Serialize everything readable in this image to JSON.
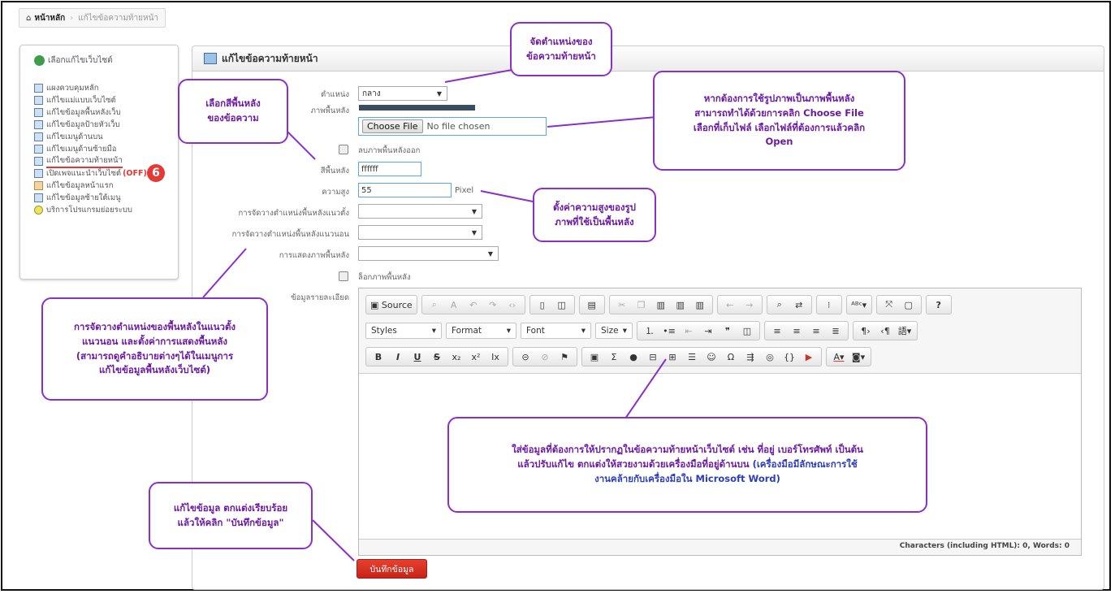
{
  "breadcrumb": {
    "home": "หน้าหลัก",
    "current": "แก้ไขข้อความท้ายหน้า"
  },
  "sidebar": {
    "heading": "เลือกแก้ไขเว็บไซต์",
    "items": [
      {
        "label": "แผงควบคุมหลัก"
      },
      {
        "label": "แก้ไขแม่แบบเว็บไซต์"
      },
      {
        "label": "แก้ไขข้อมูลพื้นหลังเว็บ"
      },
      {
        "label": "แก้ไขข้อมูลป้ายหัวเว็บ"
      },
      {
        "label": "แก้ไขเมนูด้านบน"
      },
      {
        "label": "แก้ไขเมนูด้านซ้ายมือ"
      },
      {
        "label": "แก้ไขข้อความท้ายหน้า"
      },
      {
        "label": "เปิดเพจแนะนำเว็บไซต์",
        "status": "(OFF)"
      },
      {
        "label": "แก้ไขข้อมูลหน้าแรก"
      },
      {
        "label": "แก้ไขข้อมูลซ้ายใต้เมนู"
      },
      {
        "label": "บริการโปรแกรมย่อยระบบ"
      }
    ],
    "step_badge": "6"
  },
  "panel": {
    "title": "แก้ไขข้อความท้ายหน้า"
  },
  "form": {
    "position_label": "ตำแหน่ง",
    "position_value": "กลาง",
    "bg_image_label": "ภาพพื้นหลัง",
    "choose_file": "Choose File",
    "no_file": "No file chosen",
    "remove_bg_label": "ลบภาพพื้นหลังออก",
    "bg_color_label": "สีพื้นหลัง",
    "bg_color_value": "ffffff",
    "height_label": "ความสูง",
    "height_value": "55",
    "height_unit": "Pixel",
    "vpos_label": "การจัดวางตำแหน่งพื้นหลังแนวตั้ง",
    "hpos_label": "การจัดวางตำแหน่งพื้นหลังแนวนอน",
    "display_label": "การแสดงภาพพื้นหลัง",
    "lock_bg_label": "ล็อกภาพพื้นหลัง",
    "detail_label": "ข้อมูลรายละเอียด",
    "save_button": "บันทึกข้อมูล"
  },
  "editor": {
    "source": "Source",
    "styles": "Styles",
    "format": "Format",
    "font": "Font",
    "size": "Size",
    "status": "Characters (including HTML): 0, Words: 0"
  },
  "callouts": {
    "position": [
      "จัดตำแหน่งของ",
      "ข้อความท้ายหน้า"
    ],
    "bgcolor": [
      "เลือกสีพื้นหลัง",
      "ของข้อความ"
    ],
    "bgimage": [
      "หากต้องการใช้รูปภาพเป็นภาพพื้นหลัง",
      "สามารถทำได้ด้วยการคลิก Choose File",
      "เลือกที่เก็บไฟล์ เลือกไฟล์ที่ต้องการแล้วคลิก",
      "Open"
    ],
    "height": [
      "ตั้งค่าความสูงของรูป",
      "ภาพที่ใช้เป็นพื้นหลัง"
    ],
    "position_bg": [
      "การจัดวางตำแหน่งของพื้นหลังในแนวตั้ง",
      "แนวนอน และตั้งค่าการแสดงพื้นหลัง",
      "(สามารถดูคำอธิบายต่างๆได้ในเมนูการ",
      "แก้ไขข้อมูลพื้นหลังเว็บไซต์)"
    ],
    "content_1": "ใส่ข้อมูลที่ต้องการให้ปรากฏในข้อความท้ายหน้าเว็บไซต์ เช่น ที่อยู่ เบอร์โทรศัพท์ เป็นต้น",
    "content_2a": "แล้วปรับแก้ไข ตกแต่งให้สวยงามด้วยเครื่องมือที่อยู่ด้านบน",
    "content_2b": "(เครื่องมือมีลักษณะการใช้",
    "content_3": "งานคล้ายกับเครื่องมือใน Microsoft Word)",
    "save": [
      "แก้ไขข้อมูล ตกแต่งเรียบร้อย",
      "แล้วให้คลิก \"บันทึกข้อมูล\""
    ]
  },
  "colors": {
    "callout_border": "#8b2fc9",
    "callout_text": "#6b1aa3",
    "accent_blue": "#2b3cc4",
    "save_red": "#d8321f",
    "badge": "#e53935"
  }
}
